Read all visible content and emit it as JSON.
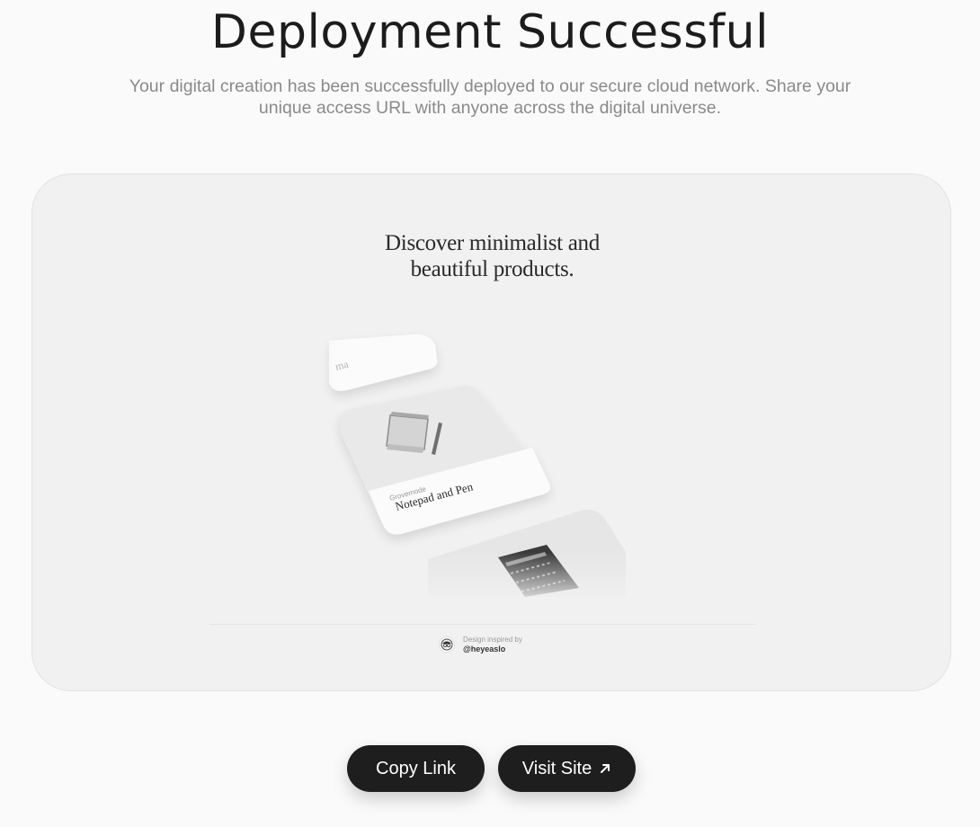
{
  "header": {
    "title": "Deployment Successful",
    "subtitle": "Your digital creation has been successfully deployed to our secure cloud network. Share your unique access URL with anyone across the digital universe."
  },
  "preview": {
    "headline_line1": "Discover minimalist and",
    "headline_line2": "beautiful products.",
    "top_card_label": "ma",
    "product_brand": "Grovemode",
    "product_name": "Notepad and Pen",
    "credit_label": "Design inspired by",
    "credit_handle": "@heyeaslo"
  },
  "actions": {
    "copy_label": "Copy Link",
    "visit_label": "Visit Site",
    "visit_icon": "arrow-up-right-icon"
  },
  "colors": {
    "background": "#fafafa",
    "card": "#f1f1f1",
    "button": "#1e1e1e",
    "button_text": "#ffffff"
  }
}
